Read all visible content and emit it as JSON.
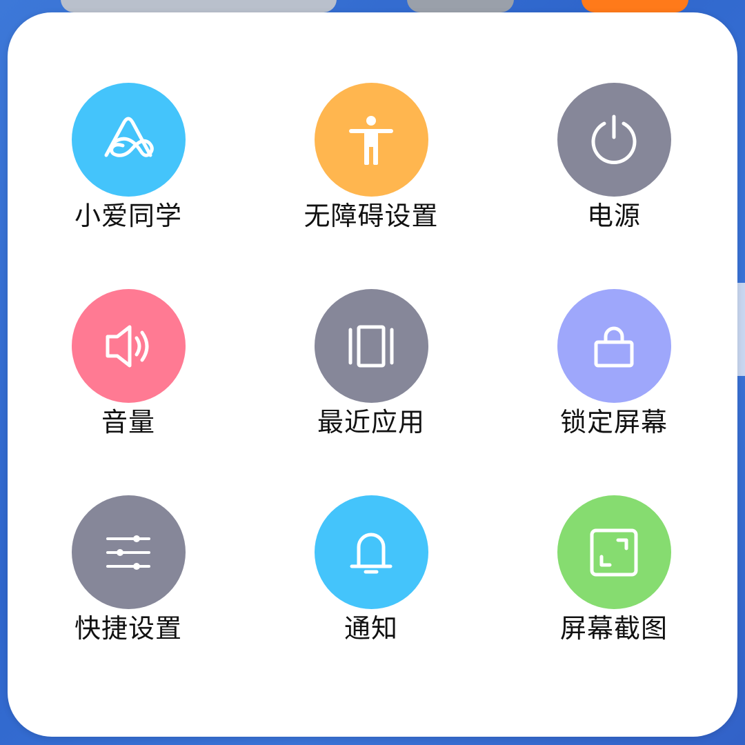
{
  "background": {
    "colors": {
      "wallpaper": "#3569d0",
      "pill_gray_light": "#b9c0cc",
      "pill_gray_dark": "#9aa0aa",
      "pill_orange": "#ff7a1a"
    }
  },
  "menu": {
    "items": [
      {
        "label": "小爱同学",
        "icon": "xiaoai-assistant-icon",
        "color": "#44c4fb"
      },
      {
        "label": "无障碍设置",
        "icon": "accessibility-person-icon",
        "color": "#ffb64f"
      },
      {
        "label": "电源",
        "icon": "power-icon",
        "color": "#868799"
      },
      {
        "label": "音量",
        "icon": "speaker-volume-icon",
        "color": "#ff7a93"
      },
      {
        "label": "最近应用",
        "icon": "recent-apps-icon",
        "color": "#868799"
      },
      {
        "label": "锁定屏幕",
        "icon": "lock-icon",
        "color": "#9ea7fb"
      },
      {
        "label": "快捷设置",
        "icon": "sliders-icon",
        "color": "#868799"
      },
      {
        "label": "通知",
        "icon": "bell-icon",
        "color": "#44c4fb"
      },
      {
        "label": "屏幕截图",
        "icon": "screenshot-frame-icon",
        "color": "#86dc70"
      }
    ]
  }
}
